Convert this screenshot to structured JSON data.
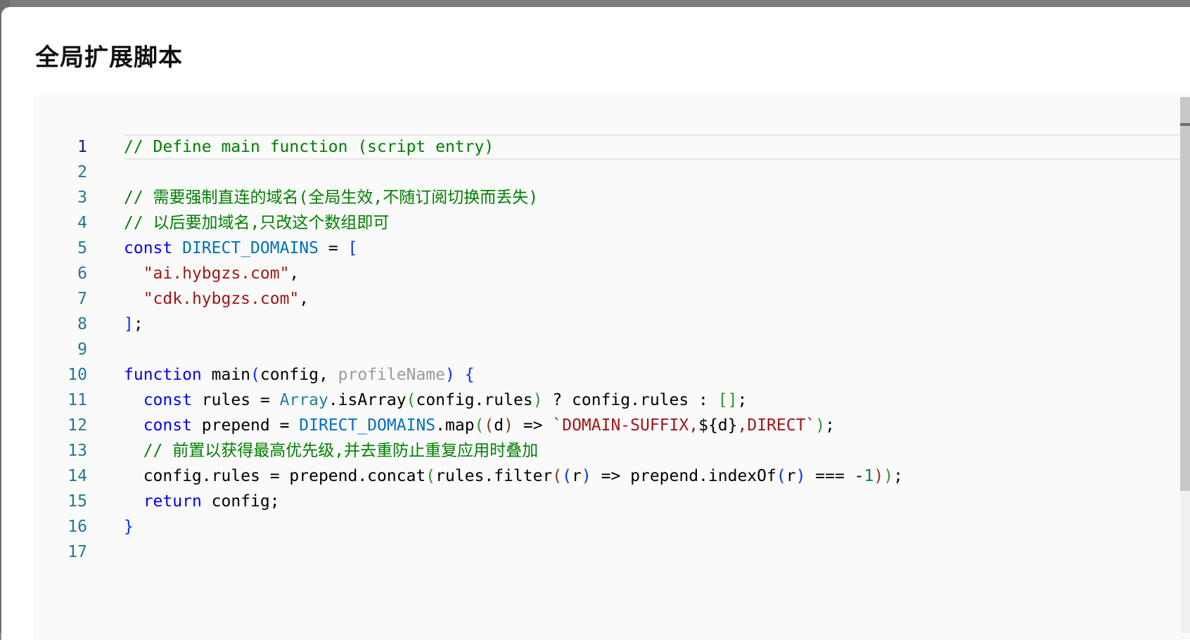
{
  "dialog": {
    "title": "全局扩展脚本"
  },
  "editor": {
    "current_line": 1,
    "lines": [
      {
        "n": "1",
        "tokens": [
          {
            "t": "// Define main function (script entry)",
            "c": "c"
          }
        ]
      },
      {
        "n": "2",
        "tokens": []
      },
      {
        "n": "3",
        "tokens": [
          {
            "t": "// 需要强制直连的域名(全局生效,不随订阅切换而丢失)",
            "c": "c"
          }
        ]
      },
      {
        "n": "4",
        "tokens": [
          {
            "t": "// 以后要加域名,只改这个数组即可",
            "c": "c"
          }
        ]
      },
      {
        "n": "5",
        "tokens": [
          {
            "t": "const",
            "c": "k"
          },
          {
            "t": " ",
            "c": "d"
          },
          {
            "t": "DIRECT_DOMAINS",
            "c": "v"
          },
          {
            "t": " = ",
            "c": "d"
          },
          {
            "t": "[",
            "c": "b1"
          }
        ]
      },
      {
        "n": "6",
        "tokens": [
          {
            "t": "  ",
            "c": "d"
          },
          {
            "t": "\"ai.hybgzs.com\"",
            "c": "s"
          },
          {
            "t": ",",
            "c": "d"
          }
        ]
      },
      {
        "n": "7",
        "tokens": [
          {
            "t": "  ",
            "c": "d"
          },
          {
            "t": "\"cdk.hybgzs.com\"",
            "c": "s"
          },
          {
            "t": ",",
            "c": "d"
          }
        ]
      },
      {
        "n": "8",
        "tokens": [
          {
            "t": "]",
            "c": "b1"
          },
          {
            "t": ";",
            "c": "d"
          }
        ]
      },
      {
        "n": "9",
        "tokens": []
      },
      {
        "n": "10",
        "tokens": [
          {
            "t": "function",
            "c": "k"
          },
          {
            "t": " main",
            "c": "d"
          },
          {
            "t": "(",
            "c": "b1"
          },
          {
            "t": "config, ",
            "c": "d"
          },
          {
            "t": "profileName",
            "c": "m"
          },
          {
            "t": ")",
            "c": "b1"
          },
          {
            "t": " ",
            "c": "d"
          },
          {
            "t": "{",
            "c": "b1"
          }
        ]
      },
      {
        "n": "11",
        "tokens": [
          {
            "t": "  ",
            "c": "d"
          },
          {
            "t": "const",
            "c": "k"
          },
          {
            "t": " rules = ",
            "c": "d"
          },
          {
            "t": "Array",
            "c": "y"
          },
          {
            "t": ".isArray",
            "c": "d"
          },
          {
            "t": "(",
            "c": "b2"
          },
          {
            "t": "config.rules",
            "c": "d"
          },
          {
            "t": ")",
            "c": "b2"
          },
          {
            "t": " ? config.rules : ",
            "c": "d"
          },
          {
            "t": "[]",
            "c": "b2"
          },
          {
            "t": ";",
            "c": "d"
          }
        ]
      },
      {
        "n": "12",
        "tokens": [
          {
            "t": "  ",
            "c": "d"
          },
          {
            "t": "const",
            "c": "k"
          },
          {
            "t": " prepend = ",
            "c": "d"
          },
          {
            "t": "DIRECT_DOMAINS",
            "c": "v"
          },
          {
            "t": ".map",
            "c": "d"
          },
          {
            "t": "(",
            "c": "b2"
          },
          {
            "t": "(",
            "c": "b3"
          },
          {
            "t": "d",
            "c": "d"
          },
          {
            "t": ")",
            "c": "b3"
          },
          {
            "t": " => ",
            "c": "d"
          },
          {
            "t": "`DOMAIN-SUFFIX,",
            "c": "s"
          },
          {
            "t": "${",
            "c": "d"
          },
          {
            "t": "d",
            "c": "d"
          },
          {
            "t": "}",
            "c": "d"
          },
          {
            "t": ",DIRECT`",
            "c": "s"
          },
          {
            "t": ")",
            "c": "b2"
          },
          {
            "t": ";",
            "c": "d"
          }
        ]
      },
      {
        "n": "13",
        "tokens": [
          {
            "t": "  ",
            "c": "d"
          },
          {
            "t": "// 前置以获得最高优先级,并去重防止重复应用时叠加",
            "c": "c"
          }
        ]
      },
      {
        "n": "14",
        "tokens": [
          {
            "t": "  config.rules = prepend.concat",
            "c": "d"
          },
          {
            "t": "(",
            "c": "b2"
          },
          {
            "t": "rules.filter",
            "c": "d"
          },
          {
            "t": "(",
            "c": "b3"
          },
          {
            "t": "(",
            "c": "b1"
          },
          {
            "t": "r",
            "c": "d"
          },
          {
            "t": ")",
            "c": "b1"
          },
          {
            "t": " => prepend.indexOf",
            "c": "d"
          },
          {
            "t": "(",
            "c": "b1"
          },
          {
            "t": "r",
            "c": "d"
          },
          {
            "t": ")",
            "c": "b1"
          },
          {
            "t": " === -",
            "c": "d"
          },
          {
            "t": "1",
            "c": "n"
          },
          {
            "t": ")",
            "c": "b3"
          },
          {
            "t": ")",
            "c": "b2"
          },
          {
            "t": ";",
            "c": "d"
          }
        ]
      },
      {
        "n": "15",
        "tokens": [
          {
            "t": "  ",
            "c": "d"
          },
          {
            "t": "return",
            "c": "k"
          },
          {
            "t": " config;",
            "c": "d"
          }
        ]
      },
      {
        "n": "16",
        "tokens": [
          {
            "t": "}",
            "c": "b1"
          }
        ]
      },
      {
        "n": "17",
        "tokens": []
      }
    ]
  },
  "colors": {
    "comment": "#008000",
    "keyword": "#0000ff",
    "variable": "#0070c1",
    "string": "#a31515",
    "type": "#267f99",
    "number": "#098658",
    "line_number": "#237893"
  }
}
